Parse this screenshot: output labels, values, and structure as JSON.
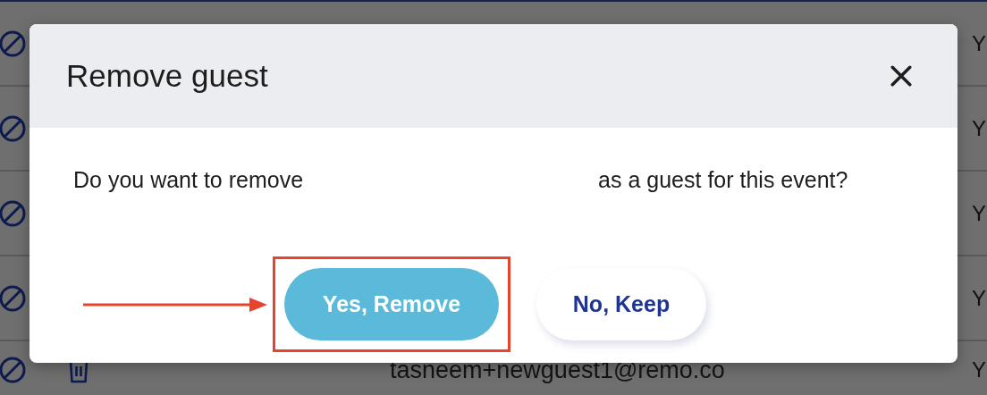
{
  "table": {
    "rows": [
      {
        "kind": "covered",
        "column_3": "Y"
      },
      {
        "kind": "covered",
        "column_3": "Y"
      },
      {
        "kind": "covered",
        "column_3": "Y"
      },
      {
        "kind": "covered",
        "column_3": "Y"
      },
      {
        "kind": "full",
        "email": "tasneem+newguest1@remo.co",
        "column_3": "Y"
      }
    ]
  },
  "dialog": {
    "title": "Remove guest",
    "message_before": "Do you want to remove",
    "message_after": "as a guest for this event?",
    "buttons": [
      {
        "label": "Yes, Remove",
        "kind": "primary",
        "highlighted": true
      },
      {
        "label": "No, Keep",
        "kind": "secondary",
        "highlighted": false
      }
    ]
  }
}
